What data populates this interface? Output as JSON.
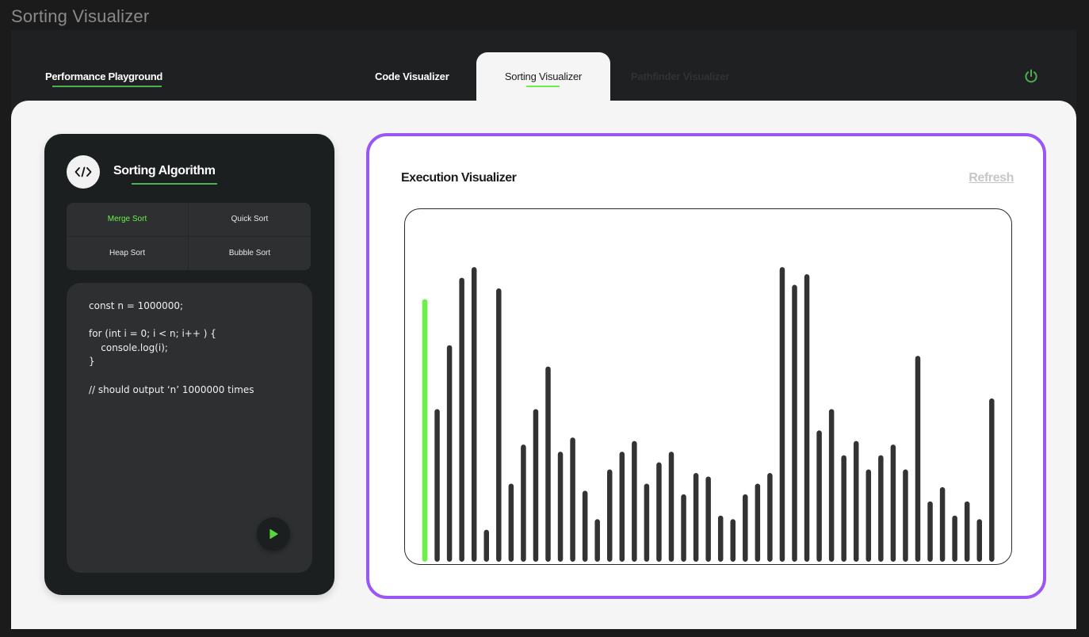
{
  "window": {
    "title": "Sorting Visualizer"
  },
  "nav": {
    "brand": "Performance Playground",
    "tabs": [
      {
        "label": "Code Visualizer",
        "active": false
      },
      {
        "label": "Sorting Visualizer",
        "active": true
      },
      {
        "label": "Pathfinder Visualizer",
        "active": false
      }
    ],
    "power_icon": "power-icon"
  },
  "algorithm_panel": {
    "icon": "code-icon",
    "title": "Sorting Algorithm",
    "options": [
      "Merge Sort",
      "Quick Sort",
      "Heap Sort",
      "Bubble Sort"
    ],
    "selected": "Merge Sort",
    "code": "const n = 1000000;\n\nfor (int i = 0; i < n; i++ ) {\n    console.log(i);\n}\n\n// should output ‘n’ 1000000 times",
    "run_icon": "play-icon"
  },
  "execution": {
    "title": "Execution Visualizer",
    "refresh_label": "Refresh",
    "highlight_color": "#6cf04a",
    "bar_color": "#333333",
    "highlight_index": 0,
    "values": [
      0.74,
      0.43,
      0.61,
      0.8,
      0.83,
      0.09,
      0.77,
      0.22,
      0.33,
      0.43,
      0.55,
      0.31,
      0.35,
      0.2,
      0.12,
      0.26,
      0.31,
      0.34,
      0.22,
      0.28,
      0.31,
      0.19,
      0.25,
      0.24,
      0.13,
      0.12,
      0.19,
      0.22,
      0.25,
      0.83,
      0.78,
      0.81,
      0.37,
      0.43,
      0.3,
      0.34,
      0.26,
      0.3,
      0.33,
      0.26,
      0.58,
      0.17,
      0.21,
      0.13,
      0.17,
      0.12,
      0.46
    ]
  }
}
